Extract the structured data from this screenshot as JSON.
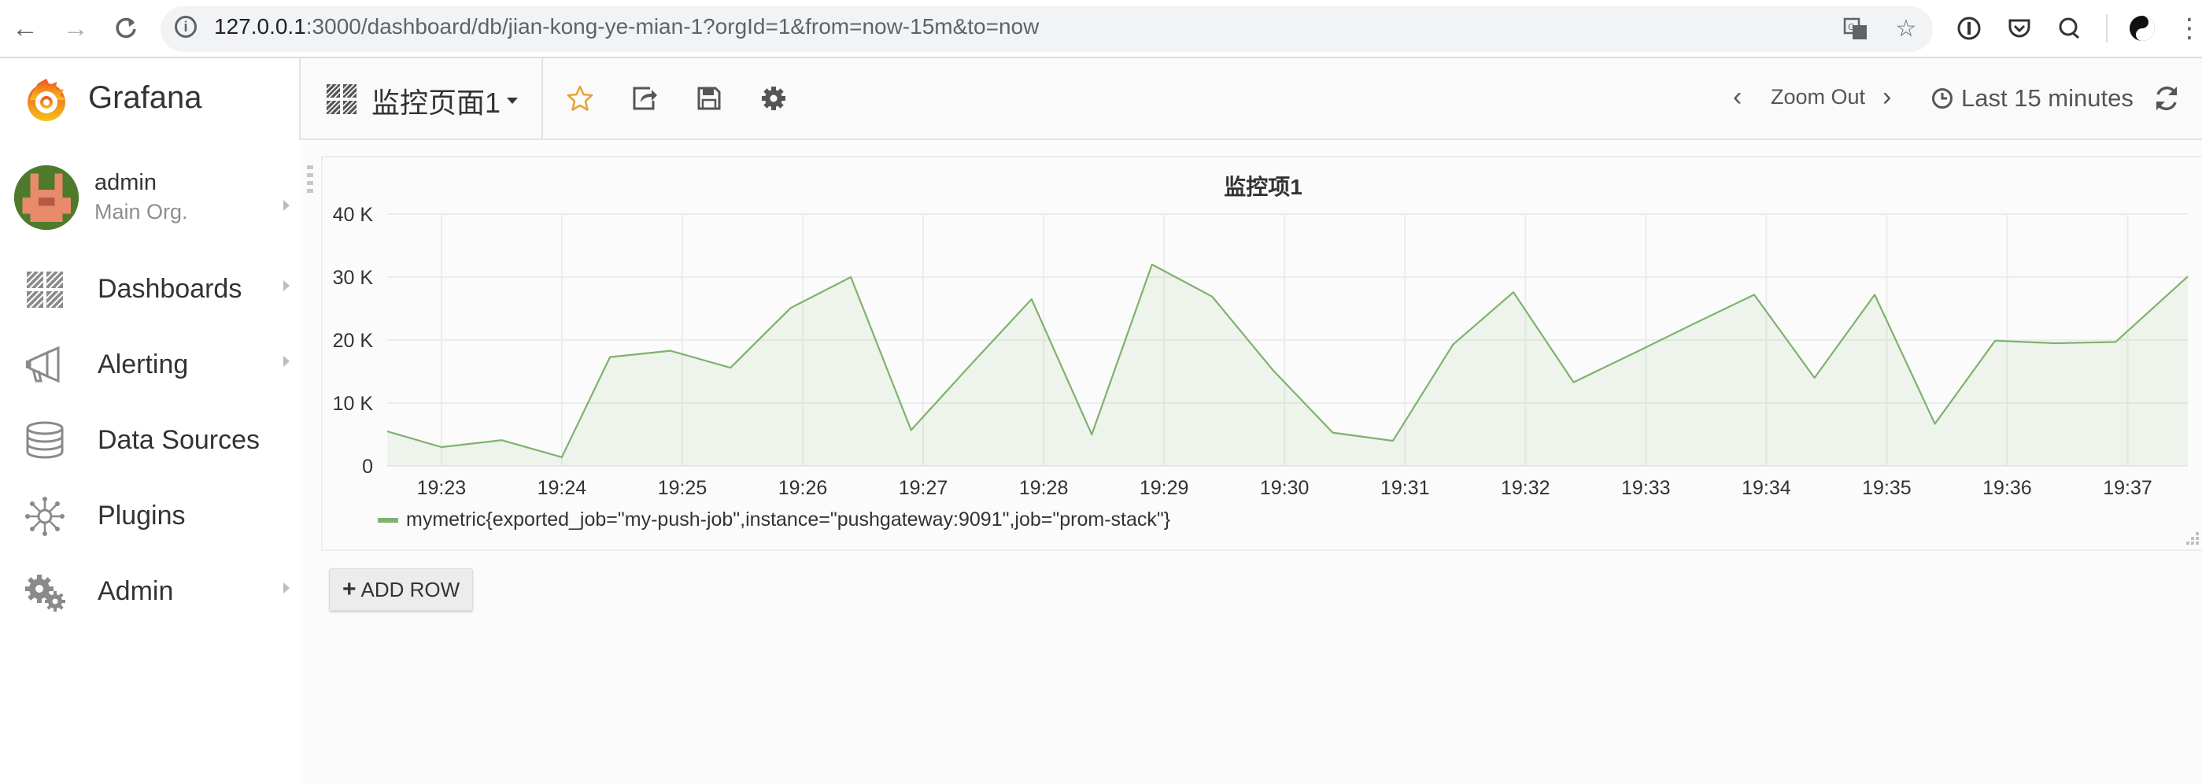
{
  "browser": {
    "url_host": "127.0.0.1",
    "url_rest": ":3000/dashboard/db/jian-kong-ye-mian-1?orgId=1&from=now-15m&to=now",
    "icons": [
      "back-icon",
      "forward-icon",
      "reload-icon",
      "info-icon",
      "translate-icon",
      "star-icon",
      "extension-1password-icon",
      "pocket-icon",
      "search-extension-icon",
      "profile-avatar-icon",
      "menu-dots-icon"
    ]
  },
  "sidebar": {
    "brand": "Grafana",
    "user": {
      "name": "admin",
      "org": "Main Org."
    },
    "items": [
      {
        "label": "Dashboards",
        "icon": "dashboards-grid-icon",
        "has_submenu": true
      },
      {
        "label": "Alerting",
        "icon": "megaphone-icon",
        "has_submenu": true
      },
      {
        "label": "Data Sources",
        "icon": "database-icon",
        "has_submenu": false
      },
      {
        "label": "Plugins",
        "icon": "plugins-icon",
        "has_submenu": false
      },
      {
        "label": "Admin",
        "icon": "gears-icon",
        "has_submenu": true
      }
    ]
  },
  "topnav": {
    "dashboard_title": "监控页面1",
    "zoom_out": "Zoom Out",
    "time_range": "Last 15 minutes",
    "star_color": "#e8a33d"
  },
  "panel": {
    "title": "监控项1",
    "legend": "mymetric{exported_job=\"my-push-job\",instance=\"pushgateway:9091\",job=\"prom-stack\"}",
    "add_row": "ADD ROW"
  },
  "chart_data": {
    "type": "area",
    "title": "监控项1",
    "ylim": [
      0,
      40000
    ],
    "y_ticks": [
      "0",
      "10 K",
      "20 K",
      "30 K",
      "40 K"
    ],
    "y_tick_values": [
      0,
      10000,
      20000,
      30000,
      40000
    ],
    "x_ticks": [
      "19:23",
      "19:24",
      "19:25",
      "19:26",
      "19:27",
      "19:28",
      "19:29",
      "19:30",
      "19:31",
      "19:32",
      "19:33",
      "19:34",
      "19:35",
      "19:36",
      "19:37"
    ],
    "x_range_minutes": [
      22.55,
      37.5
    ],
    "grid": true,
    "line_color": "#7eb26d",
    "series": [
      {
        "name": "mymetric{exported_job=\"my-push-job\",instance=\"pushgateway:9091\",job=\"prom-stack\"}",
        "x_minutes": [
          22.55,
          23.0,
          23.5,
          24.0,
          24.4,
          24.9,
          25.4,
          25.9,
          26.4,
          26.9,
          27.4,
          27.9,
          28.4,
          28.9,
          29.4,
          29.9,
          30.4,
          30.9,
          31.4,
          31.9,
          32.4,
          32.9,
          33.4,
          33.9,
          34.4,
          34.9,
          35.4,
          35.9,
          36.4,
          36.9,
          37.5
        ],
        "values": [
          5500,
          3000,
          4100,
          1400,
          17300,
          18300,
          15600,
          25100,
          30000,
          5700,
          16200,
          26500,
          5000,
          32000,
          26900,
          15300,
          5300,
          4000,
          19300,
          27600,
          13300,
          17900,
          22600,
          27200,
          14000,
          27200,
          6700,
          19900,
          19500,
          19700,
          30100
        ]
      }
    ]
  }
}
